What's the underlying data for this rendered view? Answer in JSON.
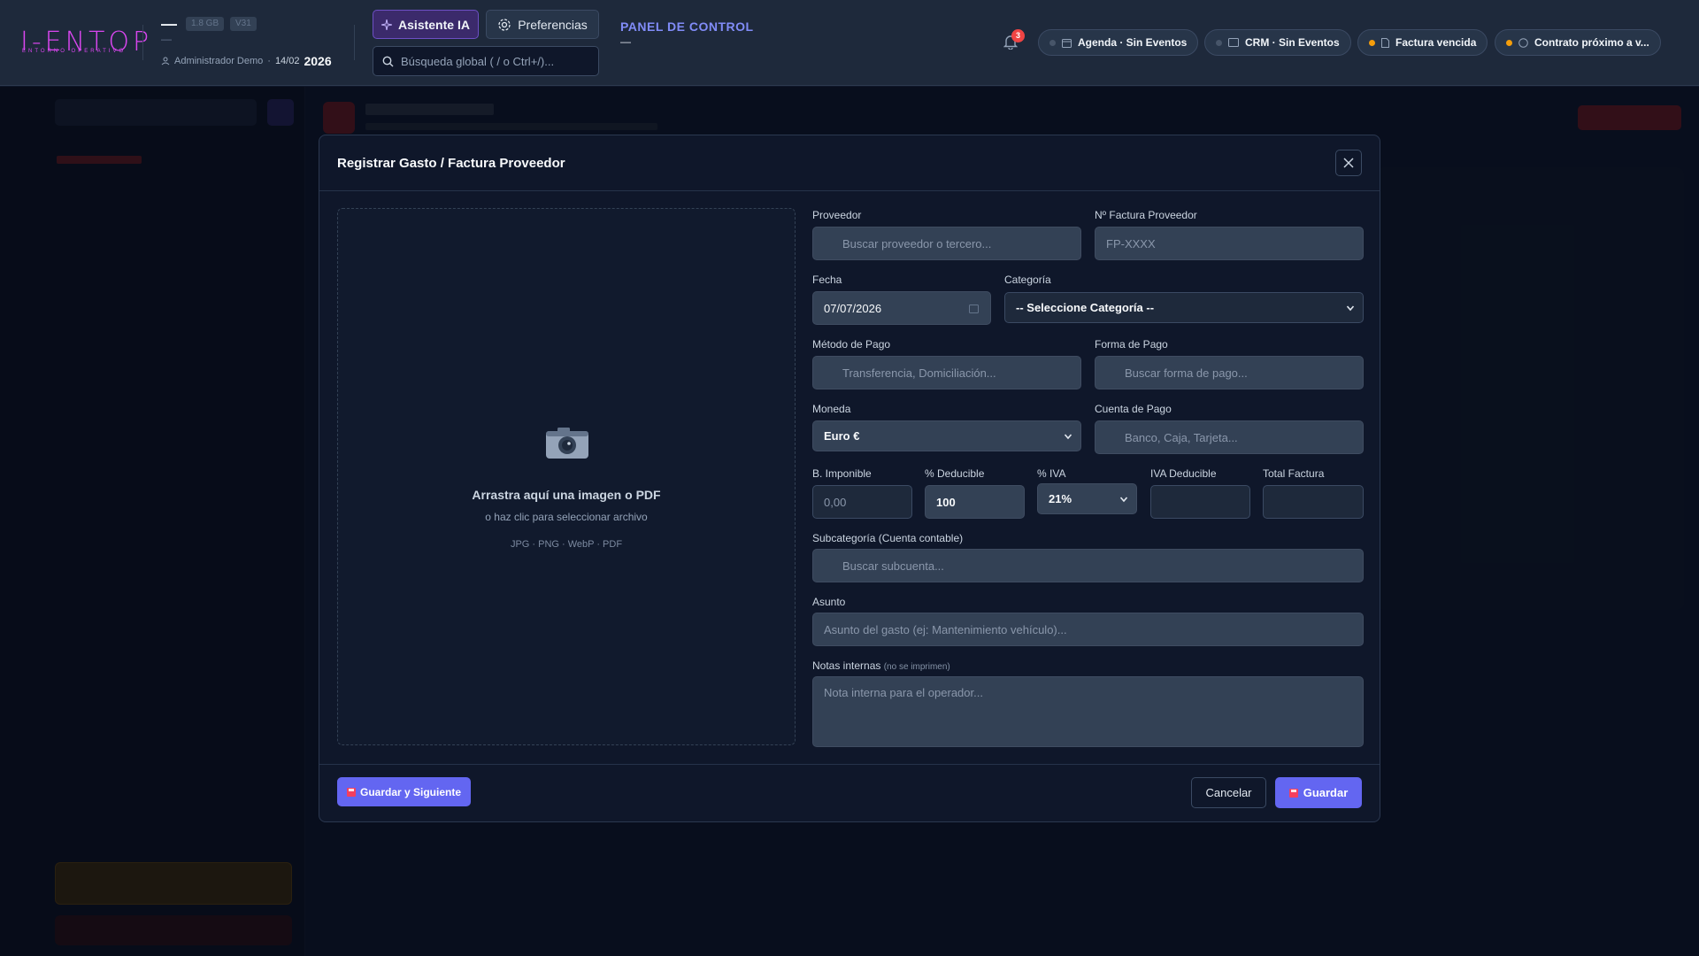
{
  "topbar": {
    "logo": "I-ENTOP",
    "logo_sub": "ENTORNO OPERATIVO",
    "primary_dash": "—",
    "storage_badge": "1.8 GB",
    "version_badge": "V31",
    "secondary_dash": "—",
    "user": "Administrador Demo",
    "separator": "·",
    "date": "14/02",
    "year": "2026",
    "ai_button": "Asistente IA",
    "prefs_button": "Preferencias",
    "search_placeholder": "Búsqueda global ( / o Ctrl+/)...",
    "panel_title": "PANEL DE CONTROL",
    "panel_sub": "—",
    "notifications_count": "3",
    "pills": [
      {
        "label": "Agenda · Sin Eventos",
        "status_color": "#475569"
      },
      {
        "label": "CRM · Sin Eventos",
        "status_color": "#475569"
      },
      {
        "label": "Factura vencida",
        "status_color": "#f59e0b"
      },
      {
        "label": "Contrato próximo a v...",
        "status_color": "#f59e0b"
      }
    ]
  },
  "modal": {
    "title": "Registrar Gasto / Factura Proveedor",
    "dropzone": {
      "title": "Arrastra aquí una imagen o PDF",
      "subtitle": "o haz clic para seleccionar archivo",
      "types": "JPG · PNG · WebP · PDF"
    },
    "fields": {
      "proveedor": {
        "label": "Proveedor",
        "placeholder": "Buscar proveedor o tercero..."
      },
      "factura": {
        "label": "Nº Factura Proveedor",
        "placeholder": "FP-XXXX"
      },
      "fecha": {
        "label": "Fecha",
        "value": "07/07/2026"
      },
      "categoria": {
        "label": "Categoría",
        "value": "-- Seleccione Categoría --"
      },
      "metodo": {
        "label": "Método de Pago",
        "placeholder": "Transferencia, Domiciliación..."
      },
      "forma": {
        "label": "Forma de Pago",
        "placeholder": "Buscar forma de pago..."
      },
      "moneda": {
        "label": "Moneda",
        "value": "Euro €"
      },
      "cuenta": {
        "label": "Cuenta de Pago",
        "placeholder": "Banco, Caja, Tarjeta..."
      },
      "base": {
        "label": "B. Imponible",
        "placeholder": "0,00"
      },
      "deducible": {
        "label": "% Deducible",
        "value": "100"
      },
      "iva": {
        "label": "% IVA",
        "value": "21%"
      },
      "iva_deducible": {
        "label": "IVA Deducible",
        "value": ""
      },
      "total": {
        "label": "Total Factura",
        "value": ""
      },
      "subcategoria": {
        "label": "Subcategoría (Cuenta contable)",
        "placeholder": "Buscar subcuenta..."
      },
      "asunto": {
        "label": "Asunto",
        "placeholder": "Asunto del gasto (ej: Mantenimiento vehículo)..."
      },
      "notas": {
        "label": "Notas internas",
        "hint": "(no se imprimen)",
        "placeholder": "Nota interna para el operador..."
      }
    },
    "buttons": {
      "save_next": "Guardar y Siguiente",
      "cancel": "Cancelar",
      "save": "Guardar"
    }
  }
}
